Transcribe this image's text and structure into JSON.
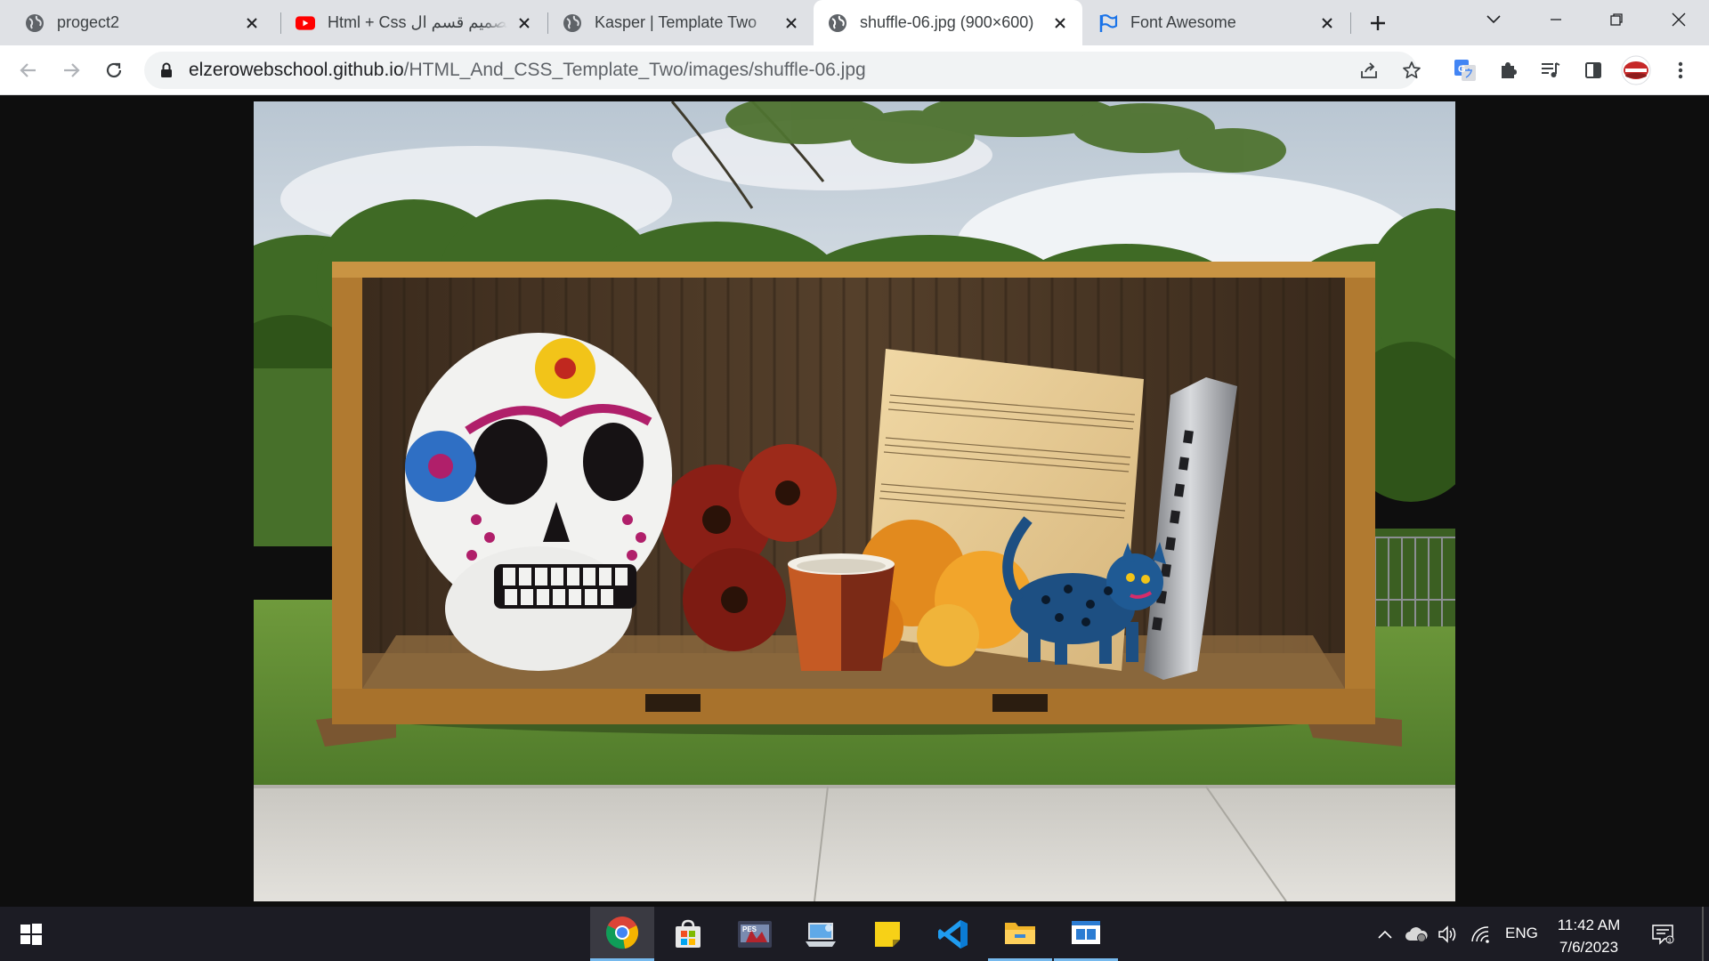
{
  "browser": {
    "tabs": [
      {
        "title": "progect2",
        "icon": "globe-icon",
        "active": false
      },
      {
        "title": "Html + Css تصميم قسم ال",
        "icon": "youtube-icon",
        "active": false
      },
      {
        "title": "Kasper | Template Two",
        "icon": "globe-icon",
        "active": false
      },
      {
        "title": "shuffle-06.jpg (900×600)",
        "icon": "globe-icon",
        "active": true
      },
      {
        "title": "Font Awesome",
        "icon": "flag-icon",
        "active": false
      }
    ],
    "url": {
      "host": "elzerowebschool.github.io",
      "path": "/HTML_And_CSS_Template_Two/images/shuffle-06.jpg"
    },
    "colors": {
      "tabstrip": "#dfe1e5",
      "active_tab": "#ffffff",
      "youtube": "#ff0000",
      "flag": "#1a73e8"
    }
  },
  "content": {
    "image": "shuffle-06.jpg",
    "image_size": "900×600"
  },
  "taskbar": {
    "apps": [
      "chrome-icon",
      "microsoft-store-icon",
      "game-icon",
      "laptop-app-icon",
      "sticky-notes-icon",
      "vscode-icon",
      "file-explorer-icon",
      "window-app-icon"
    ],
    "language": "ENG",
    "time": "11:42 AM",
    "date": "7/6/2023",
    "accent": "#76b9ed"
  }
}
